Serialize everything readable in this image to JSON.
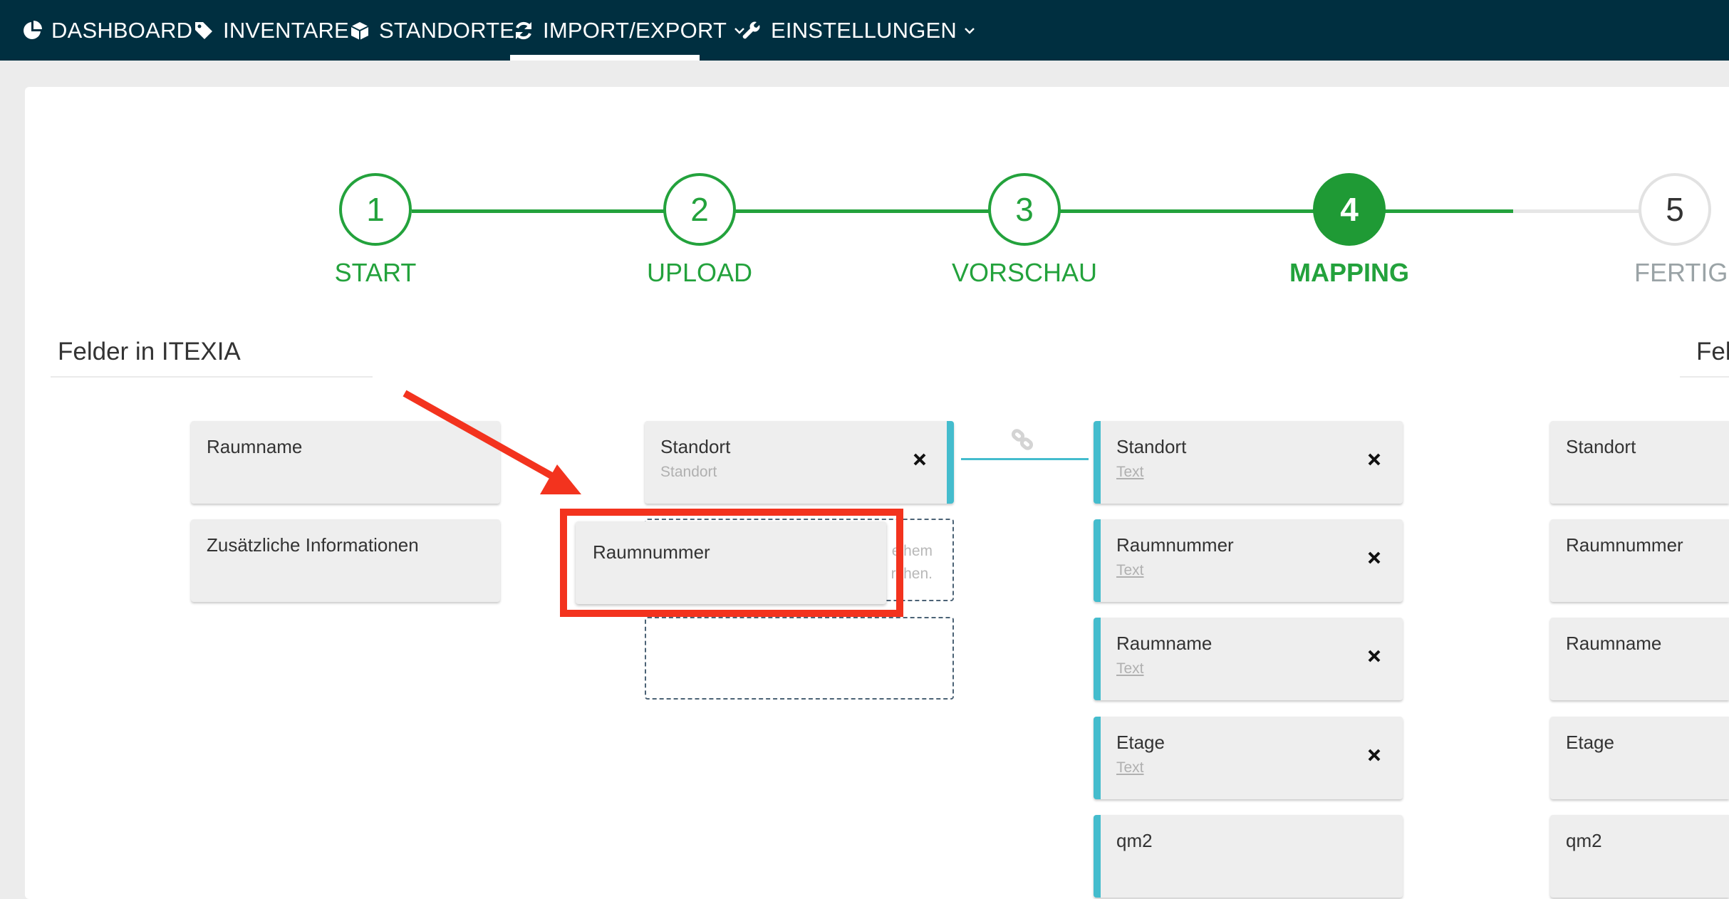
{
  "nav": {
    "items": [
      {
        "label": "DASHBOARD",
        "icon": "pie-chart-icon"
      },
      {
        "label": "INVENTARE",
        "icon": "tag-icon"
      },
      {
        "label": "STANDORTE",
        "icon": "cube-icon"
      },
      {
        "label": "IMPORT/EXPORT",
        "icon": "refresh-icon",
        "dropdown": true,
        "active": true
      },
      {
        "label": "EINSTELLUNGEN",
        "icon": "wrench-icon",
        "dropdown": true
      }
    ],
    "background": "#002f40"
  },
  "stepper": {
    "steps": [
      {
        "number": "1",
        "label": "START",
        "state": "done"
      },
      {
        "number": "2",
        "label": "UPLOAD",
        "state": "done"
      },
      {
        "number": "3",
        "label": "VORSCHAU",
        "state": "done"
      },
      {
        "number": "4",
        "label": "MAPPING",
        "state": "active"
      },
      {
        "number": "5",
        "label": "FERTIG",
        "state": "todo"
      }
    ],
    "accent": "#23a23c"
  },
  "left_section": {
    "title": "Felder in ITEXIA",
    "unmapped_fields": [
      "Raumname",
      "Zusätzliche Informationen"
    ],
    "mapped_fields": [
      {
        "label": "Standort",
        "type": "Standort"
      }
    ],
    "dropzone_text": "eihem\nrchen."
  },
  "dragging_card": {
    "label": "Raumnummer"
  },
  "file_fields": [
    {
      "label": "Standort",
      "type": "Text"
    },
    {
      "label": "Raumnummer",
      "type": "Text"
    },
    {
      "label": "Raumname",
      "type": "Text"
    },
    {
      "label": "Etage",
      "type": "Text"
    },
    {
      "label": "qm2"
    }
  ],
  "right_section": {
    "title": "Fel",
    "fields": [
      "Standort",
      "Raumnummer",
      "Raumname",
      "Etage",
      "qm2"
    ]
  },
  "colors": {
    "connector": "#44bccd",
    "highlight": "#f3331e"
  }
}
